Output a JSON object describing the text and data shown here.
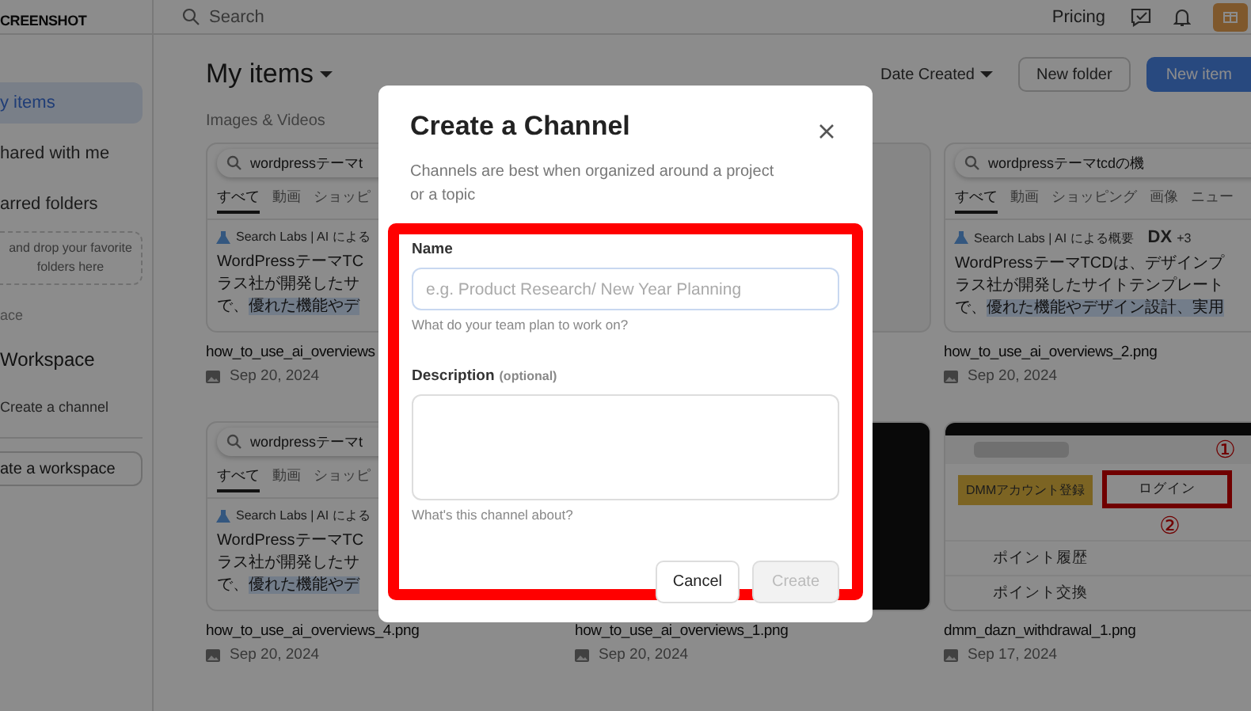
{
  "header": {
    "logo": "CREENSHOT",
    "search_placeholder": "Search",
    "pricing": "Pricing"
  },
  "sidebar": {
    "items": [
      {
        "label": "y items",
        "selected": true
      },
      {
        "label": "hared with me",
        "selected": false
      },
      {
        "label": "arred folders",
        "selected": false
      }
    ],
    "drop_hint": "and drop your favorite folders here",
    "section": "ace",
    "workspace": "Workspace",
    "create_channel": "Create a channel",
    "create_workspace": "ate a workspace"
  },
  "main": {
    "title": "My items",
    "sort": "Date Created",
    "new_folder": "New folder",
    "new_item": "New item",
    "section": "Images & Videos",
    "cards": [
      {
        "name": "how_to_use_ai_overviews",
        "date": "Sep 20, 2024",
        "thumb": {
          "kind": "search",
          "query": "wordpressテーマt",
          "tabs": [
            "すべて",
            "動画",
            "ショッピ"
          ],
          "labs": "Search Labs | AI による",
          "lines": [
            "WordPressテーマTC",
            "ラス社が開発したサ"
          ],
          "last_line": "で、",
          "highlighted": "優れた機能やデ"
        }
      },
      {
        "thumb": {
          "kind": "blank"
        }
      },
      {
        "name": "how_to_use_ai_overviews_2.png",
        "date": "Sep 20, 2024",
        "thumb": {
          "kind": "search",
          "query": "wordpressテーマtcdの機",
          "tabs": [
            "すべて",
            "動画",
            "ショッピング",
            "画像",
            "ニュー"
          ],
          "labs": "Search Labs | AI による概要",
          "badge": "DX",
          "badge_count": "+3",
          "lines": [
            "WordPressテーマTCDは、デザインプ",
            "ラス社が開発したサイトテンプレート"
          ],
          "last_line": "で、",
          "highlighted": "優れた機能やデザイン設計、実用"
        }
      },
      {
        "name": "how_to_use_ai_overviews_4.png",
        "date": "Sep 20, 2024",
        "thumb": {
          "kind": "search",
          "query": "wordpressテーマt",
          "tabs": [
            "すべて",
            "動画",
            "ショッピ"
          ],
          "labs": "Search Labs | AI による",
          "lines": [
            "WordPressテーマTC",
            "ラス社が開発したサ"
          ],
          "last_line": "で、",
          "highlighted": "優れた機能やデ"
        }
      },
      {
        "name": "how_to_use_ai_overviews_1.png",
        "date": "Sep 20, 2024",
        "thumb": {
          "kind": "dark"
        }
      },
      {
        "name": "dmm_dazn_withdrawal_1.png",
        "date": "Sep 17, 2024",
        "thumb": {
          "kind": "dmm",
          "marker_1": "①",
          "register": "DMMアカウント登録",
          "login": "ログイン",
          "marker_2": "②",
          "menu": [
            "ポイント履歴",
            "ポイント交換"
          ]
        }
      }
    ]
  },
  "dialog": {
    "title": "Create a Channel",
    "subtitle": "Channels are best when organized around a project or a topic",
    "name_label": "Name",
    "name_placeholder": "e.g. Product Research/ New Year Planning",
    "name_hint": "What do your team plan to work on?",
    "description_label": "Description",
    "description_optional": "(optional)",
    "description_hint": "What's this channel about?",
    "cancel": "Cancel",
    "create": "Create",
    "create_disabled": true
  }
}
